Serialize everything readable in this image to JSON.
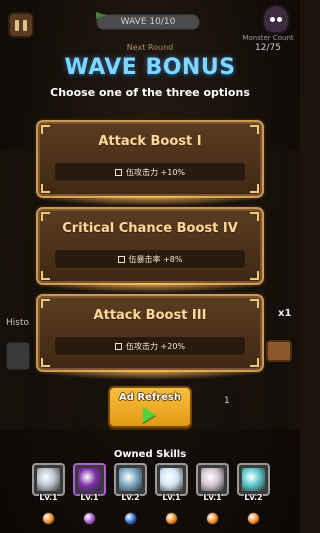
{
  "hud": {
    "wave_label": "WAVE 10/10",
    "next_round_label": "Next Round",
    "monster_count_label": "Monster Count",
    "monster_count_value": "12/75"
  },
  "popup": {
    "title": "WAVE BONUS",
    "subtitle": "Choose one of the three options"
  },
  "options": [
    {
      "title": "Attack Boost I",
      "effect": "伍攻击力 +10%"
    },
    {
      "title": "Critical Chance Boost IV",
      "effect": "伍暴击率 +8%"
    },
    {
      "title": "Attack Boost III",
      "effect": "伍攻击力 +20%"
    }
  ],
  "side": {
    "history_label": "Histo",
    "speed_label": "x1"
  },
  "ad_refresh": {
    "label": "Ad Refresh",
    "count": "1"
  },
  "owned_skills": {
    "title": "Owned Skills",
    "skills": [
      {
        "level": "Lv.1",
        "frame_color": "#9a9a9a",
        "art_color": "#b9c3cc",
        "orb_color": "#f08a1c",
        "icon": "sword-icon"
      },
      {
        "level": "Lv.1",
        "frame_color": "#b25cd6",
        "art_color": "#7b2fa6",
        "orb_color": "#a453d8",
        "icon": "magic-orb-icon"
      },
      {
        "level": "Lv.2",
        "frame_color": "#9a9a9a",
        "art_color": "#7aa7c2",
        "orb_color": "#2a6bd8",
        "icon": "blade-icon"
      },
      {
        "level": "Lv.1",
        "frame_color": "#9a9a9a",
        "art_color": "#cfe3ef",
        "orb_color": "#f08a1c",
        "icon": "crescent-icon"
      },
      {
        "level": "Lv.1",
        "frame_color": "#9a9a9a",
        "art_color": "#d0c3cf",
        "orb_color": "#f08a1c",
        "icon": "slash-icon"
      },
      {
        "level": "Lv.2",
        "frame_color": "#9a9a9a",
        "art_color": "#58c7c9",
        "orb_color": "#f08a1c",
        "icon": "wave-slash-icon"
      }
    ]
  }
}
